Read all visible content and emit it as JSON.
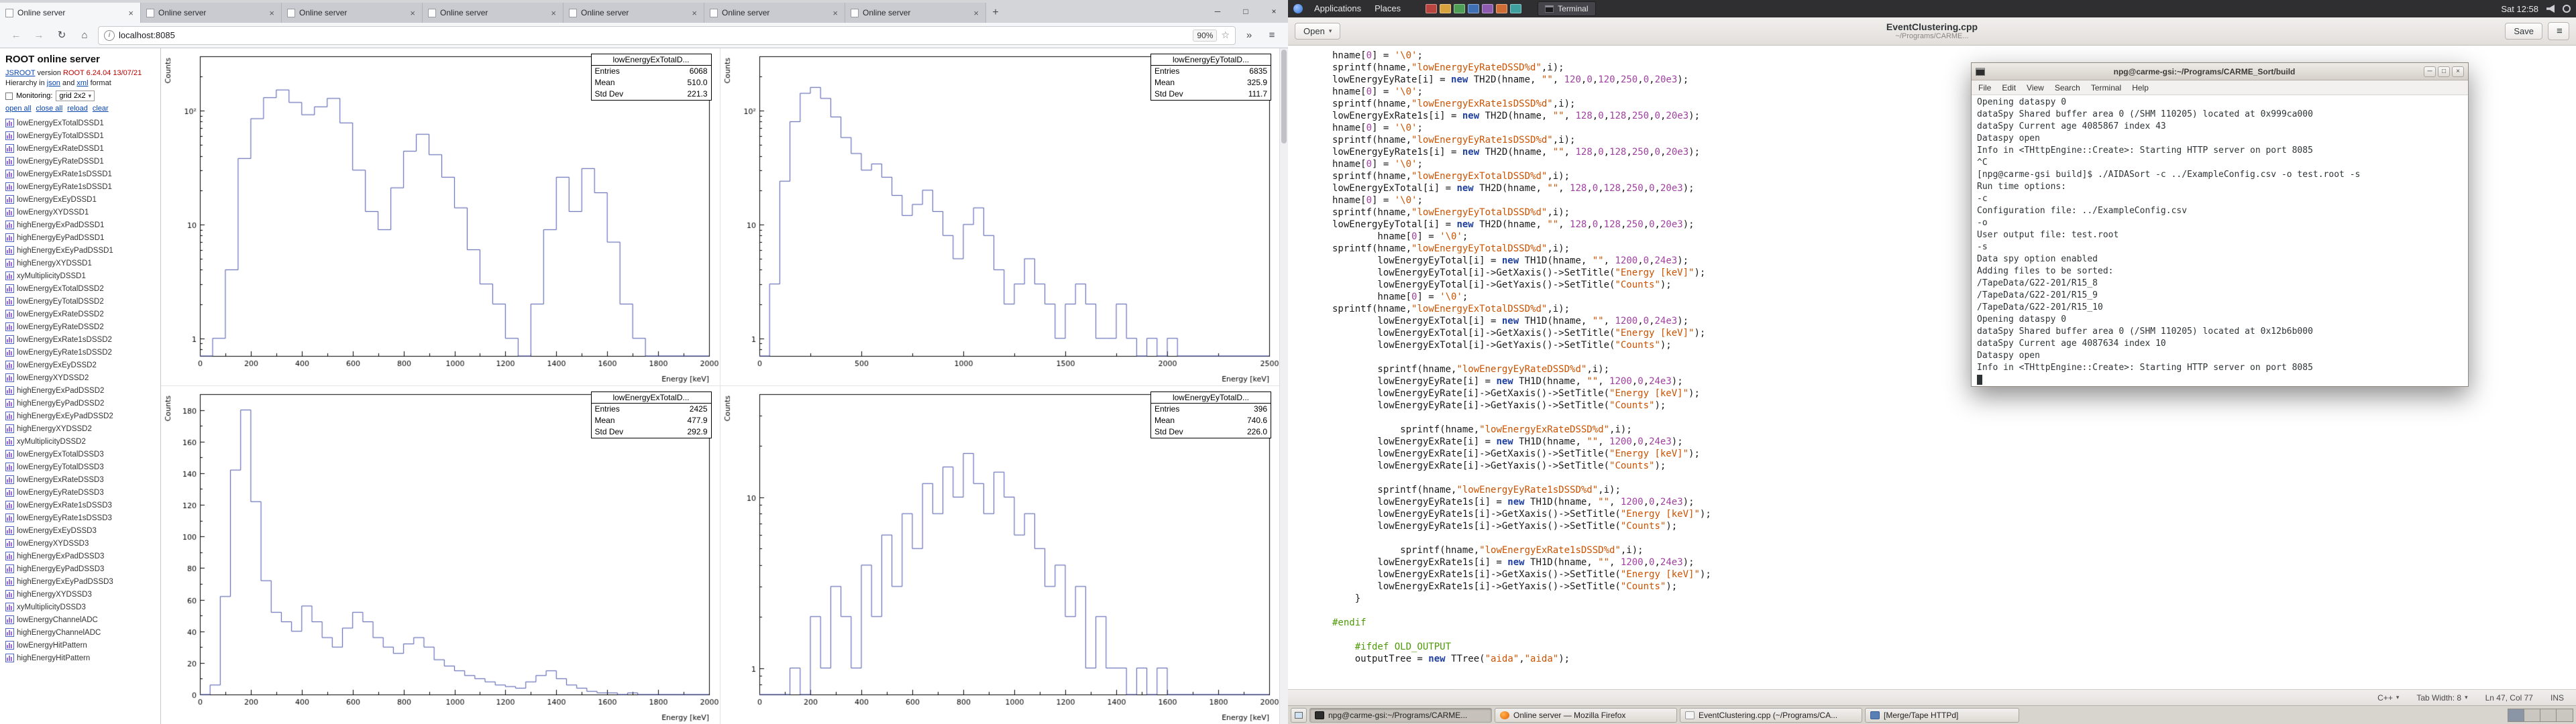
{
  "browser": {
    "tabs": [
      "Online server",
      "Online server",
      "Online server",
      "Online server",
      "Online server",
      "Online server",
      "Online server"
    ],
    "new_tab_label": "+",
    "window_controls": [
      "─",
      "□",
      "×"
    ],
    "nav": {
      "back": "←",
      "forward": "→",
      "reload": "↻",
      "home": "⌂",
      "info": "i",
      "overflow": "»",
      "menu": "≡",
      "bookmark": "☆"
    },
    "url": "localhost:8085",
    "zoom": "90%"
  },
  "jsroot": {
    "title": "ROOT online server",
    "version": {
      "link": "JSROOT",
      "text": " version ",
      "ver": "ROOT 6.24.04 13/07/21"
    },
    "hierarchy": {
      "pre": "Hierarchy in ",
      "json": "json",
      "and": " and ",
      "xml": "xml",
      "post": " format"
    },
    "monitoring_label": "Monitoring:",
    "layout_value": "grid 2x2",
    "layout_caret": "▾",
    "actions": [
      "open all",
      "close all",
      "reload",
      "clear"
    ],
    "items": [
      "lowEnergyExTotalDSSD1",
      "lowEnergyEyTotalDSSD1",
      "lowEnergyExRateDSSD1",
      "lowEnergyEyRateDSSD1",
      "lowEnergyExRate1sDSSD1",
      "lowEnergyEyRate1sDSSD1",
      "lowEnergyExEyDSSD1",
      "lowEnergyXYDSSD1",
      "highEnergyExPadDSSD1",
      "highEnergyEyPadDSSD1",
      "highEnergyExEyPadDSSD1",
      "highEnergyXYDSSD1",
      "xyMultiplicityDSSD1",
      "lowEnergyExTotalDSSD2",
      "lowEnergyEyTotalDSSD2",
      "lowEnergyExRateDSSD2",
      "lowEnergyEyRateDSSD2",
      "lowEnergyExRate1sDSSD2",
      "lowEnergyEyRate1sDSSD2",
      "lowEnergyExEyDSSD2",
      "lowEnergyXYDSSD2",
      "highEnergyExPadDSSD2",
      "highEnergyEyPadDSSD2",
      "highEnergyExEyPadDSSD2",
      "highEnergyXYDSSD2",
      "xyMultiplicityDSSD2",
      "lowEnergyExTotalDSSD3",
      "lowEnergyEyTotalDSSD3",
      "lowEnergyExRateDSSD3",
      "lowEnergyEyRateDSSD3",
      "lowEnergyExRate1sDSSD3",
      "lowEnergyEyRate1sDSSD3",
      "lowEnergyExEyDSSD3",
      "lowEnergyXYDSSD3",
      "highEnergyExPadDSSD3",
      "highEnergyEyPadDSSD3",
      "highEnergyExEyPadDSSD3",
      "highEnergyXYDSSD3",
      "xyMultiplicityDSSD3",
      "lowEnergyChannelADC",
      "highEnergyChannelADC",
      "lowEnergyHitPattern",
      "highEnergyHitPattern"
    ]
  },
  "stats_labels": [
    "Entries",
    "Mean",
    "Std Dev"
  ],
  "chart_data": [
    {
      "type": "histogram",
      "name": "lowEnergyExTotalD...",
      "xlabel": "Energy [keV]",
      "ylabel": "Counts",
      "yscale": "log",
      "xlim": [
        0,
        2000
      ],
      "ylim": [
        0.7,
        300
      ],
      "bin_width": 50,
      "values": [
        0,
        1,
        4,
        38,
        85,
        130,
        152,
        118,
        92,
        108,
        128,
        78,
        30,
        13,
        9,
        21,
        44,
        62,
        41,
        26,
        14,
        6,
        3,
        2,
        1,
        0,
        2,
        9,
        26,
        13,
        31,
        19,
        7,
        2,
        1,
        0,
        0,
        0,
        0,
        0
      ],
      "xticks": [
        0,
        200,
        400,
        600,
        800,
        1000,
        1200,
        1400,
        1600,
        1800,
        2000
      ],
      "yticks": [
        {
          "v": 1,
          "label": "1"
        },
        {
          "v": 10,
          "label": "10"
        },
        {
          "v": 100,
          "label": "10²"
        }
      ],
      "stats": {
        "entries": "6068",
        "mean": "510.0",
        "std_dev": "221.3"
      },
      "line_color": "#4a55aa"
    },
    {
      "type": "histogram",
      "name": "lowEnergyEyTotalD...",
      "xlabel": "Energy [keV]",
      "ylabel": "Counts",
      "yscale": "log",
      "xlim": [
        0,
        2500
      ],
      "ylim": [
        0.7,
        300
      ],
      "bin_width": 50,
      "values": [
        0,
        3,
        24,
        80,
        142,
        160,
        128,
        88,
        58,
        42,
        30,
        34,
        26,
        18,
        12,
        15,
        20,
        13,
        8,
        5,
        10,
        14,
        8,
        4,
        2,
        3,
        5,
        3,
        2,
        1,
        2,
        3,
        2,
        1,
        1,
        2,
        1,
        0,
        1,
        0,
        1,
        0,
        0,
        0,
        0,
        0,
        0,
        0,
        0,
        0
      ],
      "xticks": [
        0,
        500,
        1000,
        1500,
        2000,
        2500
      ],
      "yticks": [
        {
          "v": 1,
          "label": "1"
        },
        {
          "v": 10,
          "label": "10"
        },
        {
          "v": 100,
          "label": "10²"
        }
      ],
      "stats": {
        "entries": "6835",
        "mean": "325.9",
        "std_dev": "111.7"
      },
      "line_color": "#4a55aa"
    },
    {
      "type": "histogram",
      "name": "lowEnergyExTotalD...",
      "xlabel": "Energy [keV]",
      "ylabel": "Counts",
      "yscale": "linear",
      "xlim": [
        0,
        2000
      ],
      "ylim": [
        0,
        190
      ],
      "bin_width": 40,
      "values": [
        0,
        6,
        62,
        142,
        180,
        122,
        72,
        52,
        46,
        40,
        56,
        46,
        36,
        30,
        42,
        52,
        46,
        36,
        30,
        26,
        32,
        36,
        30,
        22,
        18,
        15,
        12,
        10,
        8,
        6,
        5,
        4,
        8,
        12,
        15,
        10,
        6,
        4,
        2,
        1,
        1,
        0,
        1,
        0,
        0,
        0,
        0,
        0,
        0,
        0
      ],
      "xticks": [
        0,
        200,
        400,
        600,
        800,
        1000,
        1200,
        1400,
        1600,
        1800,
        2000
      ],
      "yticks": [
        {
          "v": 0,
          "label": "0"
        },
        {
          "v": 20,
          "label": "20"
        },
        {
          "v": 40,
          "label": "40"
        },
        {
          "v": 60,
          "label": "60"
        },
        {
          "v": 80,
          "label": "80"
        },
        {
          "v": 100,
          "label": "100"
        },
        {
          "v": 120,
          "label": "120"
        },
        {
          "v": 140,
          "label": "140"
        },
        {
          "v": 160,
          "label": "160"
        },
        {
          "v": 180,
          "label": "180"
        }
      ],
      "stats": {
        "entries": "2425",
        "mean": "477.9",
        "std_dev": "292.9"
      },
      "line_color": "#4a55aa"
    },
    {
      "type": "histogram",
      "name": "lowEnergyEyTotalD...",
      "xlabel": "Energy [keV]",
      "ylabel": "Counts",
      "yscale": "log",
      "xlim": [
        0,
        2000
      ],
      "ylim": [
        0.7,
        40
      ],
      "bin_width": 40,
      "values": [
        0,
        0,
        0,
        1,
        0,
        2,
        1,
        3,
        2,
        1,
        4,
        2,
        6,
        3,
        8,
        5,
        12,
        8,
        15,
        10,
        18,
        12,
        8,
        14,
        10,
        6,
        8,
        5,
        3,
        4,
        2,
        3,
        1,
        2,
        1,
        1,
        0,
        1,
        0,
        1,
        0,
        0,
        0,
        0,
        0,
        0,
        0,
        0,
        0,
        0
      ],
      "xticks": [
        0,
        200,
        400,
        600,
        800,
        1000,
        1200,
        1400,
        1600,
        1800,
        2000
      ],
      "yticks": [
        {
          "v": 1,
          "label": "1"
        },
        {
          "v": 10,
          "label": "10"
        }
      ],
      "stats": {
        "entries": "396",
        "mean": "740.6",
        "std_dev": "226.0"
      },
      "line_color": "#4a55aa"
    }
  ],
  "desktop": {
    "panel": {
      "menus": [
        "Applications",
        "Places"
      ],
      "launcher_colors": [
        "#b8453f",
        "#d8a33c",
        "#4f9e55",
        "#3f6fb5",
        "#8e5bb0",
        "#cf6d35",
        "#3fa0a0"
      ],
      "window_button": "Terminal",
      "clock": "Sat 12:58"
    },
    "taskbar": {
      "buttons": [
        {
          "label": "npg@carme-gsi:~/Programs/CARME...",
          "icon": "terminal-icon",
          "active": true
        },
        {
          "label": "Online server — Mozilla Firefox",
          "icon": "firefox-icon",
          "active": false
        },
        {
          "label": "EventClustering.cpp (~/Programs/CA...",
          "icon": "text-editor-icon",
          "active": false
        },
        {
          "label": "[Merge/Tape HTTPd]",
          "icon": "window-icon",
          "active": false
        }
      ]
    }
  },
  "editor": {
    "open_label": "Open",
    "open_caret": "▾",
    "title": "EventClustering.cpp",
    "subtitle": "~/Programs/CARME...",
    "save_label": "Save",
    "menu_icon": "≡",
    "status": {
      "lang": "C++",
      "tab_width": "Tab Width: 8",
      "position": "Ln 47, Col 77",
      "mode": "INS",
      "caret": "▾"
    },
    "code_lines": [
      "hname[0] = '\\0';",
      "sprintf(hname,\"lowEnergyEyRateDSSD%d\",i);",
      "lowEnergyEyRate[i] = new TH2D(hname, \"\", 120,0,120,250,0,20e3);",
      "hname[0] = '\\0';",
      "sprintf(hname,\"lowEnergyExRate1sDSSD%d\",i);",
      "lowEnergyExRate1s[i] = new TH2D(hname, \"\", 128,0,128,250,0,20e3);",
      "hname[0] = '\\0';",
      "sprintf(hname,\"lowEnergyEyRate1sDSSD%d\",i);",
      "lowEnergyEyRate1s[i] = new TH2D(hname, \"\", 128,0,128,250,0,20e3);",
      "hname[0] = '\\0';",
      "sprintf(hname,\"lowEnergyExTotalDSSD%d\",i);",
      "lowEnergyExTotal[i] = new TH2D(hname, \"\", 128,0,128,250,0,20e3);",
      "hname[0] = '\\0';",
      "sprintf(hname,\"lowEnergyEyTotalDSSD%d\",i);",
      "lowEnergyEyTotal[i] = new TH2D(hname, \"\", 128,0,128,250,0,20e3);",
      "        hname[0] = '\\0';",
      "sprintf(hname,\"lowEnergyEyTotalDSSD%d\",i);",
      "        lowEnergyEyTotal[i] = new TH1D(hname, \"\", 1200,0,24e3);",
      "        lowEnergyEyTotal[i]->GetXaxis()->SetTitle(\"Energy [keV]\");",
      "        lowEnergyEyTotal[i]->GetYaxis()->SetTitle(\"Counts\");",
      "        hname[0] = '\\0';",
      "sprintf(hname,\"lowEnergyExTotalDSSD%d\",i);",
      "        lowEnergyExTotal[i] = new TH1D(hname, \"\", 1200,0,24e3);",
      "        lowEnergyExTotal[i]->GetXaxis()->SetTitle(\"Energy [keV]\");",
      "        lowEnergyExTotal[i]->GetYaxis()->SetTitle(\"Counts\");",
      "",
      "        sprintf(hname,\"lowEnergyEyRateDSSD%d\",i);",
      "        lowEnergyEyRate[i] = new TH1D(hname, \"\", 1200,0,24e3);",
      "        lowEnergyEyRate[i]->GetXaxis()->SetTitle(\"Energy [keV]\");",
      "        lowEnergyEyRate[i]->GetYaxis()->SetTitle(\"Counts\");",
      "",
      "            sprintf(hname,\"lowEnergyExRateDSSD%d\",i);",
      "        lowEnergyExRate[i] = new TH1D(hname, \"\", 1200,0,24e3);",
      "        lowEnergyExRate[i]->GetXaxis()->SetTitle(\"Energy [keV]\");",
      "        lowEnergyExRate[i]->GetYaxis()->SetTitle(\"Counts\");",
      "",
      "        sprintf(hname,\"lowEnergyEyRate1sDSSD%d\",i);",
      "        lowEnergyEyRate1s[i] = new TH1D(hname, \"\", 1200,0,24e3);",
      "        lowEnergyEyRate1s[i]->GetXaxis()->SetTitle(\"Energy [keV]\");",
      "        lowEnergyEyRate1s[i]->GetYaxis()->SetTitle(\"Counts\");",
      "",
      "            sprintf(hname,\"lowEnergyExRate1sDSSD%d\",i);",
      "        lowEnergyExRate1s[i] = new TH1D(hname, \"\", 1200,0,24e3);",
      "        lowEnergyExRate1s[i]->GetXaxis()->SetTitle(\"Energy [keV]\");",
      "        lowEnergyExRate1s[i]->GetYaxis()->SetTitle(\"Counts\");",
      "    }",
      "",
      "#endif",
      "",
      "    #ifdef OLD_OUTPUT",
      "    outputTree = new TTree(\"aida\",\"aida\");"
    ]
  },
  "terminal": {
    "title": "npg@carme-gsi:~/Programs/CARME_Sort/build",
    "controls": [
      "─",
      "□",
      "×"
    ],
    "menu": [
      "File",
      "Edit",
      "View",
      "Search",
      "Terminal",
      "Help"
    ],
    "lines": [
      "Opening dataspy 0",
      "dataSpy Shared buffer area 0 (/SHM 110205) located at 0x999ca000",
      "dataSpy Current age 4085867 index 43",
      "Dataspy open",
      "Info in <THttpEngine::Create>: Starting HTTP server on port 8085",
      "^C",
      "[npg@carme-gsi build]$ ./AIDASort -c ../ExampleConfig.csv -o test.root -s",
      "Run time options:",
      "-c",
      "Configuration file: ../ExampleConfig.csv",
      "-o",
      "User output file: test.root",
      "-s",
      "Data spy option enabled",
      "Adding files to be sorted:",
      "/TapeData/G22-201/R15_8",
      "/TapeData/G22-201/R15_9",
      "/TapeData/G22-201/R15_10",
      "Opening dataspy 0",
      "dataSpy Shared buffer area 0 (/SHM 110205) located at 0x12b6b000",
      "dataSpy Current age 4087634 index 10",
      "Dataspy open",
      "Info in <THttpEngine::Create>: Starting HTTP server on port 8085"
    ]
  }
}
